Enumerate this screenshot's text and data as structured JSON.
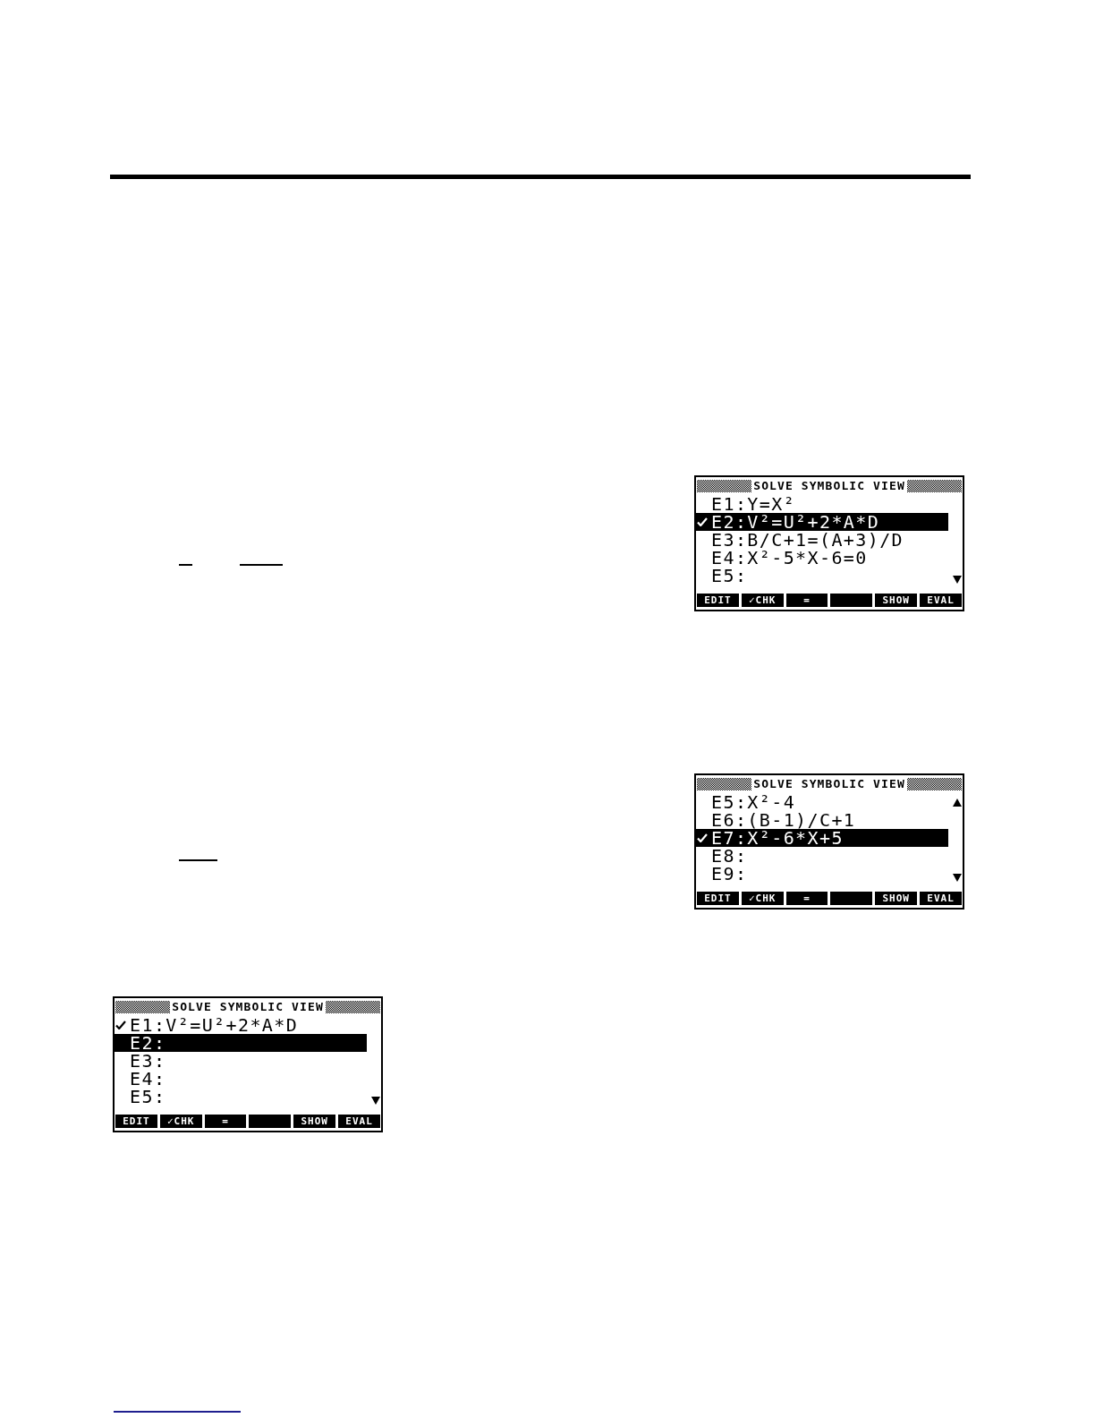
{
  "screens": [
    {
      "title": "SOLVE SYMBOLIC VIEW",
      "more_above": false,
      "more_below": true,
      "rows": [
        {
          "text": "E1:Y=X²",
          "checked": false,
          "selected": false
        },
        {
          "text": "E2:V²=U²+2*A*D",
          "checked": true,
          "selected": true
        },
        {
          "text": "E3:B/C+1=(A+3)/D",
          "checked": false,
          "selected": false
        },
        {
          "text": "E4:X²-5*X-6=0",
          "checked": false,
          "selected": false
        },
        {
          "text": "E5:",
          "checked": false,
          "selected": false
        }
      ],
      "softkeys": [
        {
          "kind": "key",
          "label": "EDIT"
        },
        {
          "kind": "key",
          "label": "✓CHK"
        },
        {
          "kind": "key",
          "label": "="
        },
        {
          "kind": "blank"
        },
        {
          "kind": "key",
          "label": "SHOW"
        },
        {
          "kind": "key",
          "label": "EVAL"
        }
      ]
    },
    {
      "title": "SOLVE SYMBOLIC VIEW",
      "more_above": true,
      "more_below": true,
      "rows": [
        {
          "text": "E5:X²-4",
          "checked": false,
          "selected": false
        },
        {
          "text": "E6:(B-1)/C+1",
          "checked": false,
          "selected": false
        },
        {
          "text": "E7:X²-6*X+5",
          "checked": true,
          "selected": true
        },
        {
          "text": "E8:",
          "checked": false,
          "selected": false
        },
        {
          "text": "E9:",
          "checked": false,
          "selected": false
        }
      ],
      "softkeys": [
        {
          "kind": "key",
          "label": "EDIT"
        },
        {
          "kind": "key",
          "label": "✓CHK"
        },
        {
          "kind": "key",
          "label": "="
        },
        {
          "kind": "blank"
        },
        {
          "kind": "key",
          "label": "SHOW"
        },
        {
          "kind": "key",
          "label": "EVAL"
        }
      ]
    },
    {
      "title": "SOLVE SYMBOLIC VIEW",
      "more_above": false,
      "more_below": true,
      "rows": [
        {
          "text": "E1:V²=U²+2*A*D",
          "checked": true,
          "selected": false
        },
        {
          "text": "E2:",
          "checked": false,
          "selected": true
        },
        {
          "text": "E3:",
          "checked": false,
          "selected": false
        },
        {
          "text": "E4:",
          "checked": false,
          "selected": false
        },
        {
          "text": "E5:",
          "checked": false,
          "selected": false
        }
      ],
      "softkeys": [
        {
          "kind": "key",
          "label": "EDIT"
        },
        {
          "kind": "key",
          "label": "✓CHK"
        },
        {
          "kind": "key",
          "label": "="
        },
        {
          "kind": "blank"
        },
        {
          "kind": "key",
          "label": "SHOW"
        },
        {
          "kind": "key",
          "label": "EVAL"
        }
      ]
    }
  ]
}
